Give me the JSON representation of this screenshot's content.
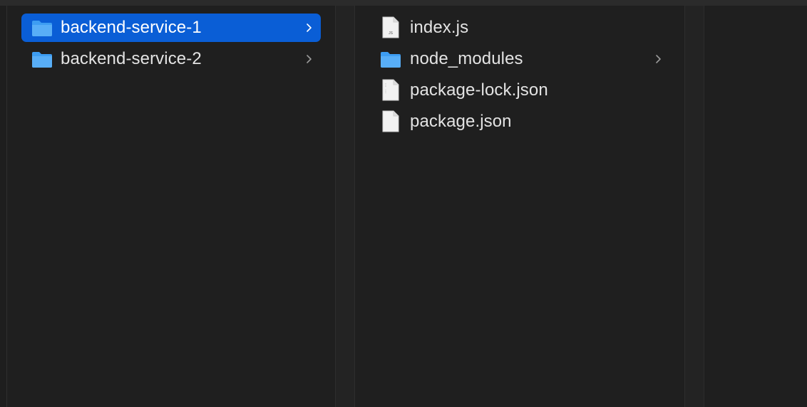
{
  "columns": [
    {
      "items": [
        {
          "label": "backend-service-1",
          "type": "folder",
          "selected": true,
          "has_children": true
        },
        {
          "label": "backend-service-2",
          "type": "folder",
          "selected": false,
          "has_children": true
        }
      ]
    },
    {
      "items": [
        {
          "label": "index.js",
          "type": "file",
          "badge": "JS",
          "selected": false
        },
        {
          "label": "node_modules",
          "type": "folder",
          "selected": false,
          "has_children": true
        },
        {
          "label": "package-lock.json",
          "type": "file",
          "badge": "",
          "selected": false
        },
        {
          "label": "package.json",
          "type": "file",
          "badge": "",
          "selected": false
        }
      ]
    }
  ],
  "colors": {
    "background": "#1e1e1e",
    "selection": "#0a5ed6",
    "folder": "#3d9df2",
    "text": "#e3e3e3"
  }
}
